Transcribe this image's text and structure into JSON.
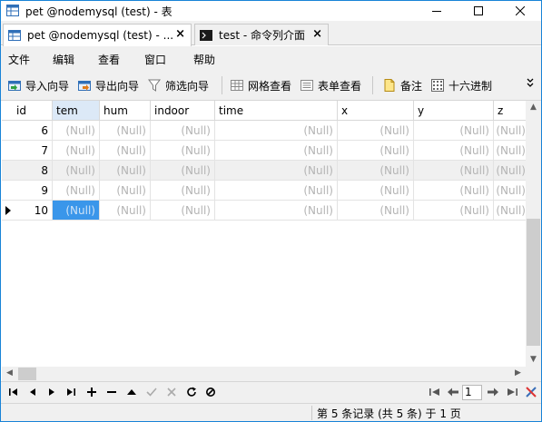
{
  "window": {
    "title": "pet @nodemysql (test) - 表"
  },
  "tabs": [
    {
      "label": "pet @nodemysql (test) - ...",
      "close": "×"
    },
    {
      "label": "test - 命令列介面",
      "close": "×"
    }
  ],
  "menu": [
    "文件",
    "编辑",
    "查看",
    "窗口",
    "帮助"
  ],
  "toolbar": {
    "import": "导入向导",
    "export": "导出向导",
    "filter": "筛选向导",
    "grid_view": "网格查看",
    "form_view": "表单查看",
    "memo": "备注",
    "hex": "十六进制",
    "more": "»"
  },
  "table": {
    "columns": [
      "id",
      "tem",
      "hum",
      "indoor",
      "time",
      "x",
      "y",
      "z"
    ],
    "selected_column": "tem",
    "null_text": "(Null)",
    "rows": [
      {
        "id": "6"
      },
      {
        "id": "7"
      },
      {
        "id": "8"
      },
      {
        "id": "9"
      },
      {
        "id": "10"
      }
    ],
    "current_row_id": "10",
    "selected_cell": {
      "row_id": "10",
      "column": "tem"
    }
  },
  "nav": {
    "page": "1"
  },
  "status": {
    "text": "第 5 条记录 (共 5 条) 于 1 页"
  }
}
